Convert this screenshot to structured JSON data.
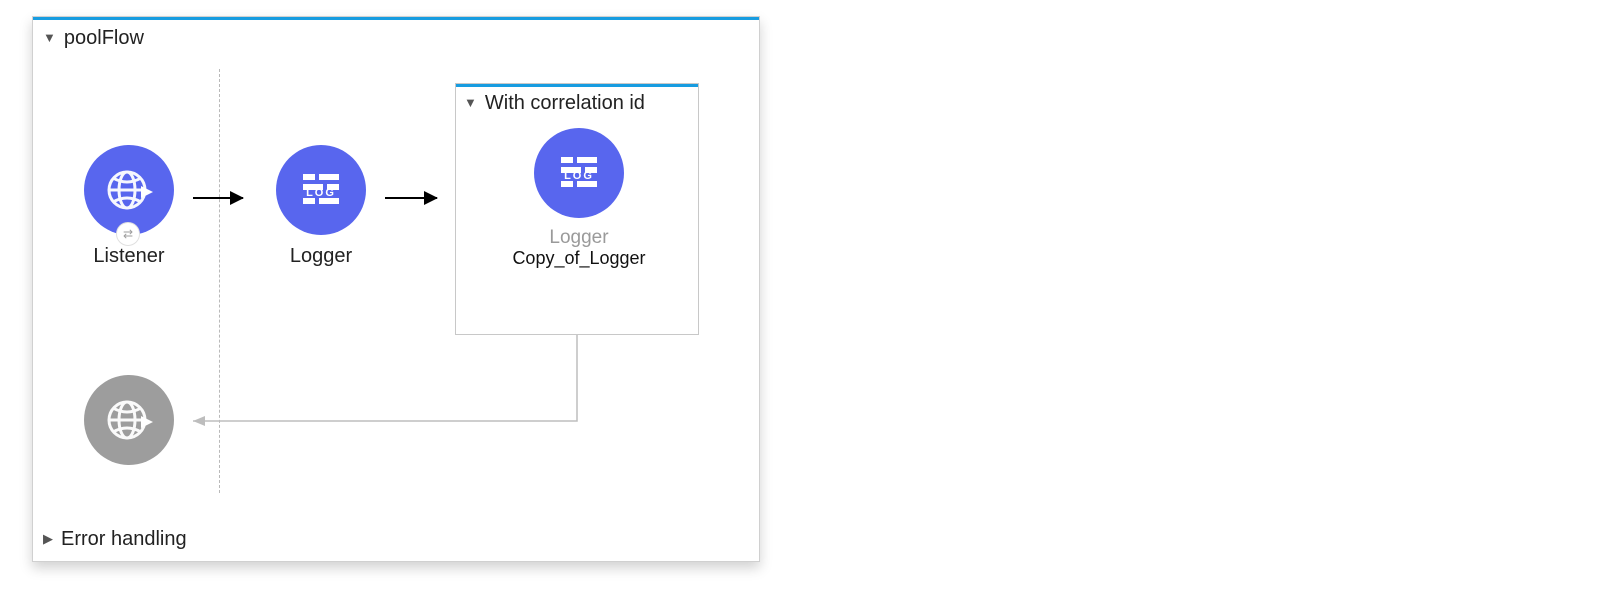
{
  "colors": {
    "node_fill": "#5866ee",
    "node_fill_inactive": "#9d9d9d",
    "accent": "#179ce0"
  },
  "flow": {
    "title": "poolFlow",
    "expanded": true,
    "listener": {
      "label": "Listener",
      "icon": "http-globe-icon"
    },
    "logger": {
      "label": "Logger",
      "icon": "log-brick-icon"
    },
    "scope": {
      "title": "With correlation id",
      "expanded": true,
      "logger": {
        "type_label": "Logger",
        "name": "Copy_of_Logger",
        "icon": "log-brick-icon"
      }
    },
    "response": {
      "icon": "http-globe-icon"
    }
  },
  "error_section": {
    "title": "Error handling",
    "expanded": false
  }
}
